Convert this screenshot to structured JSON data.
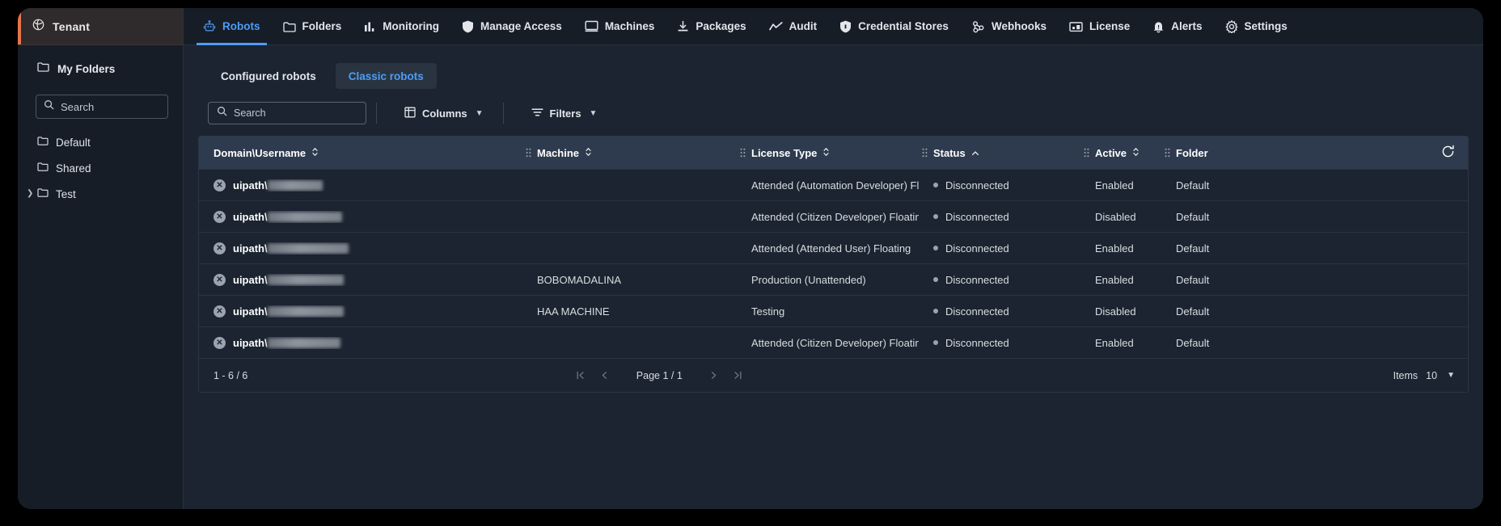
{
  "sidebar": {
    "tenant": {
      "label": "Tenant",
      "icon": "globe-icon"
    },
    "my_folders": {
      "label": "My Folders",
      "icon": "folder-icon"
    },
    "search": {
      "placeholder": "Search",
      "value": "",
      "icon": "search-icon"
    },
    "folders": [
      {
        "label": "Default",
        "expandable": false
      },
      {
        "label": "Shared",
        "expandable": false
      },
      {
        "label": "Test",
        "expandable": true
      }
    ]
  },
  "topnav": {
    "tabs": [
      {
        "label": "Robots",
        "icon": "robot-icon",
        "active": true
      },
      {
        "label": "Folders",
        "icon": "folder-icon",
        "active": false
      },
      {
        "label": "Monitoring",
        "icon": "bar-chart-icon",
        "active": false
      },
      {
        "label": "Manage Access",
        "icon": "shield-icon",
        "active": false
      },
      {
        "label": "Machines",
        "icon": "monitor-icon",
        "active": false
      },
      {
        "label": "Packages",
        "icon": "download-icon",
        "active": false
      },
      {
        "label": "Audit",
        "icon": "trend-line-icon",
        "active": false
      },
      {
        "label": "Credential Stores",
        "icon": "shield-lock-icon",
        "active": false
      },
      {
        "label": "Webhooks",
        "icon": "webhook-icon",
        "active": false
      },
      {
        "label": "License",
        "icon": "license-icon",
        "active": false
      },
      {
        "label": "Alerts",
        "icon": "bell-alert-icon",
        "active": false
      },
      {
        "label": "Settings",
        "icon": "gear-icon",
        "active": false
      }
    ]
  },
  "subtabs": [
    {
      "label": "Configured robots",
      "active": false
    },
    {
      "label": "Classic robots",
      "active": true
    }
  ],
  "toolbar": {
    "search": {
      "placeholder": "Search",
      "value": "",
      "icon": "search-icon"
    },
    "columns_label": "Columns",
    "filters_label": "Filters",
    "columns_icon": "table-columns-icon",
    "filters_icon": "filter-icon",
    "chevron_icon": "chevron-down-icon"
  },
  "table": {
    "refresh_icon": "refresh-icon",
    "columns": [
      {
        "label": "Domain\\Username",
        "sort": "none"
      },
      {
        "label": "Machine",
        "sort": "none"
      },
      {
        "label": "License Type",
        "sort": "none"
      },
      {
        "label": "Status",
        "sort": "asc"
      },
      {
        "label": "Active",
        "sort": "none"
      },
      {
        "label": "Folder",
        "sort": null
      }
    ],
    "rows": [
      {
        "username_prefix": "uipath\\",
        "username_redacted_width": 68,
        "machine": "",
        "license_type": "Attended (Automation Developer) Floati...",
        "status": "Disconnected",
        "active": "Enabled",
        "folder": "Default"
      },
      {
        "username_prefix": "uipath\\",
        "username_redacted_width": 92,
        "machine": "",
        "license_type": "Attended (Citizen Developer) Floating",
        "status": "Disconnected",
        "active": "Disabled",
        "folder": "Default"
      },
      {
        "username_prefix": "uipath\\",
        "username_redacted_width": 100,
        "machine": "",
        "license_type": "Attended (Attended User) Floating",
        "status": "Disconnected",
        "active": "Enabled",
        "folder": "Default"
      },
      {
        "username_prefix": "uipath\\",
        "username_redacted_width": 94,
        "machine": "BOBOMADALINA",
        "license_type": "Production (Unattended)",
        "status": "Disconnected",
        "active": "Enabled",
        "folder": "Default"
      },
      {
        "username_prefix": "uipath\\",
        "username_redacted_width": 94,
        "machine": "HAA MACHINE",
        "license_type": "Testing",
        "status": "Disconnected",
        "active": "Disabled",
        "folder": "Default"
      },
      {
        "username_prefix": "uipath\\",
        "username_redacted_width": 90,
        "machine": "",
        "license_type": "Attended (Citizen Developer) Floating",
        "status": "Disconnected",
        "active": "Enabled",
        "folder": "Default"
      }
    ]
  },
  "footer": {
    "count_text": "1 - 6 / 6",
    "first_page_icon": "first-page-icon",
    "prev_page_icon": "prev-page-icon",
    "page_label": "Page 1 / 1",
    "next_page_icon": "next-page-icon",
    "last_page_icon": "last-page-icon",
    "items_label": "Items",
    "items_value": "10",
    "items_chevron_icon": "chevron-down-icon"
  },
  "colors": {
    "accent": "#4e9cf5",
    "tenant_accent": "#e8744a",
    "header_bg": "#2e3b4e",
    "panel_bg": "#1b2430",
    "sidebar_bg": "#161d27"
  }
}
